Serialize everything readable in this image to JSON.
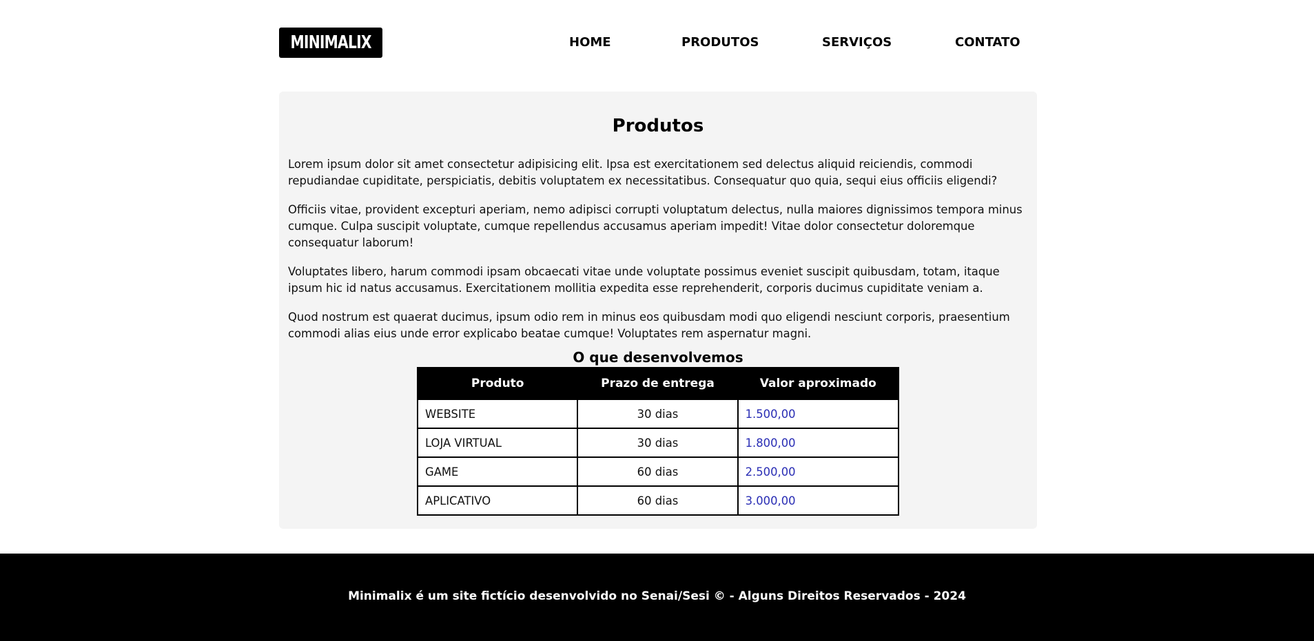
{
  "header": {
    "logo": "MINIMALIX",
    "nav": [
      "HOME",
      "PRODUTOS",
      "SERVIÇOS",
      "CONTATO"
    ]
  },
  "main": {
    "title": "Produtos",
    "paragraphs": [
      "Lorem ipsum dolor sit amet consectetur adipisicing elit. Ipsa est exercitationem sed delectus aliquid reiciendis, commodi repudiandae cupiditate, perspiciatis, debitis voluptatem ex necessitatibus. Consequatur quo quia, sequi eius officiis eligendi?",
      "Officiis vitae, provident excepturi aperiam, nemo adipisci corrupti voluptatum delectus, nulla maiores dignissimos tempora minus cumque. Culpa suscipit voluptate, cumque repellendus accusamus aperiam impedit! Vitae dolor consectetur doloremque consequatur laborum!",
      "Voluptates libero, harum commodi ipsam obcaecati vitae unde voluptate possimus eveniet suscipit quibusdam, totam, itaque ipsum hic id natus accusamus. Exercitationem mollitia expedita esse reprehenderit, corporis ducimus cupiditate veniam a.",
      "Quod nostrum est quaerat ducimus, ipsum odio rem in minus eos quibusdam modi quo eligendi nesciunt corporis, praesentium commodi alias eius unde error explicabo beatae cumque! Voluptates rem aspernatur magni."
    ],
    "table": {
      "title": "O que desenvolvemos",
      "headers": [
        "Produto",
        "Prazo de entrega",
        "Valor aproximado"
      ],
      "rows": [
        [
          "WEBSITE",
          "30 dias",
          "1.500,00"
        ],
        [
          "LOJA VIRTUAL",
          "30 dias",
          "1.800,00"
        ],
        [
          "GAME",
          "60 dias",
          "2.500,00"
        ],
        [
          "APLICATIVO",
          "60 dias",
          "3.000,00"
        ]
      ]
    }
  },
  "footer": {
    "text": "Minimalix é um site fictício desenvolvido no Senai/Sesi © - Alguns Direitos Reservados - 2024"
  },
  "colors": {
    "header_bg": "#000000",
    "card_bg": "#f4f4f4",
    "value_text": "#2b2fb5",
    "footer_bg": "#000000"
  }
}
